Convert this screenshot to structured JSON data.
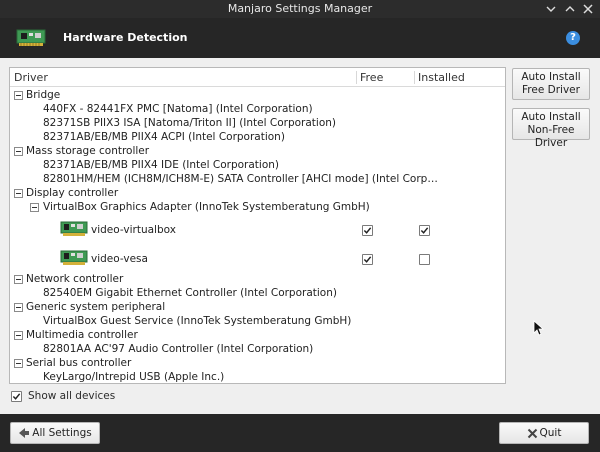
{
  "window": {
    "title": "Manjaro Settings Manager"
  },
  "header": {
    "title": "Hardware Detection",
    "help_label": "?"
  },
  "tree": {
    "columns": {
      "driver": "Driver",
      "free": "Free",
      "installed": "Installed"
    },
    "rows": [
      {
        "type": "category",
        "label": "Bridge"
      },
      {
        "type": "device",
        "label": "440FX - 82441FX PMC [Natoma] (Intel Corporation)"
      },
      {
        "type": "device",
        "label": "82371SB PIIX3 ISA [Natoma/Triton II] (Intel Corporation)"
      },
      {
        "type": "device",
        "label": "82371AB/EB/MB PIIX4 ACPI (Intel Corporation)"
      },
      {
        "type": "category",
        "label": "Mass storage controller"
      },
      {
        "type": "device",
        "label": "82371AB/EB/MB PIIX4 IDE (Intel Corporation)"
      },
      {
        "type": "device",
        "label": "82801HM/HEM (ICH8M/ICH8M-E) SATA Controller [AHCI mode] (Intel Corp…"
      },
      {
        "type": "category",
        "label": "Display controller"
      },
      {
        "type": "subdevice",
        "label": "VirtualBox Graphics Adapter (InnoTek Systemberatung GmbH)"
      },
      {
        "type": "driver",
        "label": "video-virtualbox",
        "free": true,
        "installed": true
      },
      {
        "type": "driver",
        "label": "video-vesa",
        "free": true,
        "installed": false
      },
      {
        "type": "category",
        "label": "Network controller"
      },
      {
        "type": "device",
        "label": "82540EM Gigabit Ethernet Controller (Intel Corporation)"
      },
      {
        "type": "category",
        "label": "Generic system peripheral"
      },
      {
        "type": "device",
        "label": "VirtualBox Guest Service (InnoTek Systemberatung GmbH)"
      },
      {
        "type": "category",
        "label": "Multimedia controller"
      },
      {
        "type": "device",
        "label": "82801AA AC'97 Audio Controller (Intel Corporation)"
      },
      {
        "type": "category",
        "label": "Serial bus controller"
      },
      {
        "type": "device",
        "label": "KeyLargo/Intrepid USB (Apple Inc.)"
      }
    ]
  },
  "side_buttons": {
    "auto_free": [
      "Auto Install",
      "Free Driver"
    ],
    "auto_nonfree": [
      "Auto Install",
      "Non-Free Driver"
    ]
  },
  "show_all": {
    "label": "Show all devices",
    "checked": true
  },
  "footer": {
    "all_settings": "All Settings",
    "quit": "Quit"
  },
  "icons": {
    "help": "help-icon",
    "hardware": "hardware-card-icon",
    "driver": "video-card-icon",
    "back": "back-arrow-icon",
    "quit": "close-icon",
    "collapse": "collapse-minus-icon",
    "checkbox": "checkmark-icon"
  },
  "colors": {
    "header_bg": "#262626",
    "titlebar_bg": "#2c2c2c",
    "help_accent": "#3b8ee0",
    "window_bg": "#efefef"
  }
}
